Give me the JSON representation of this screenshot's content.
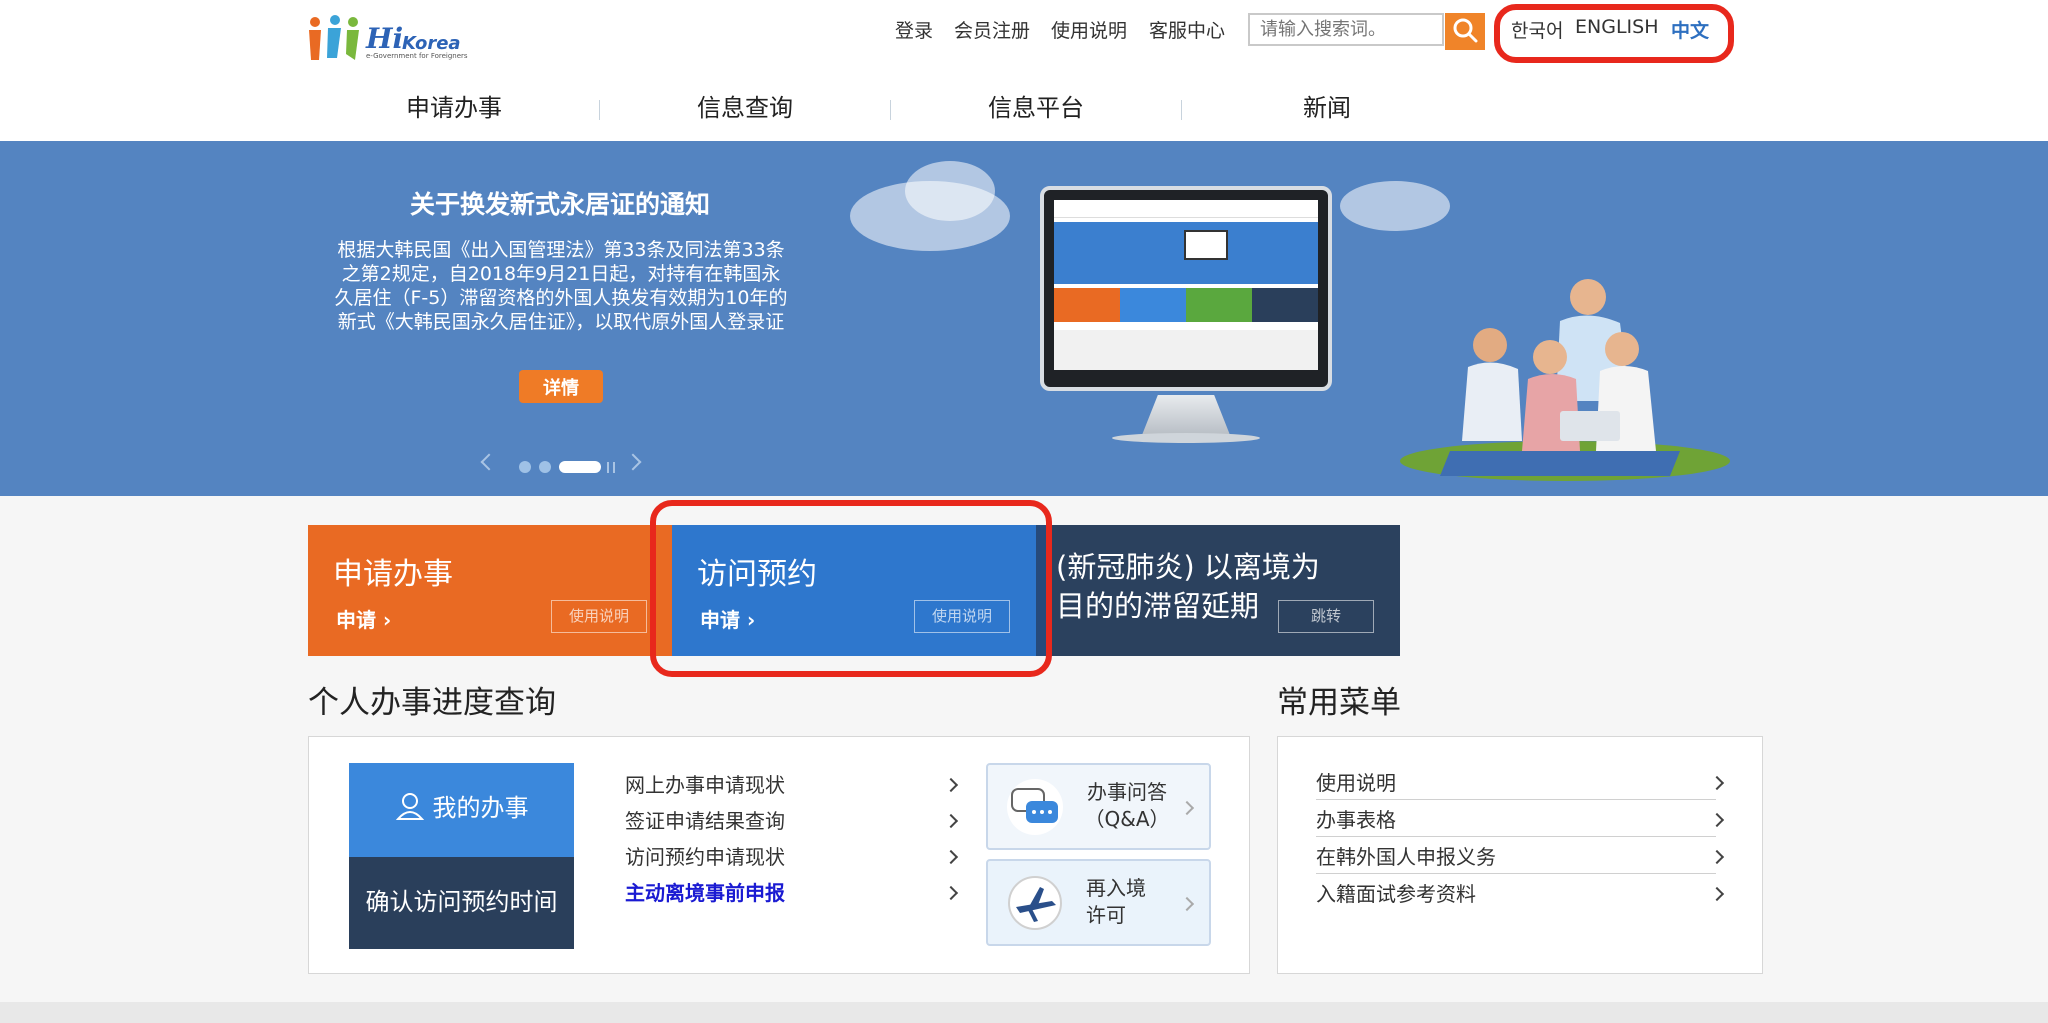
{
  "header": {
    "logo_hi": "Hi",
    "logo_korea": "Korea",
    "logo_tagline": "e-Government for Foreigners",
    "links": {
      "login": "登录",
      "register": "会员注册",
      "guide": "使用说明",
      "service": "客服中心"
    },
    "search_placeholder": "请输入搜索词。",
    "languages": {
      "korean": "한국어",
      "english": "ENGLISH",
      "chinese": "中文"
    }
  },
  "nav": {
    "apply": "申请办事",
    "inquiry": "信息查询",
    "platform": "信息平台",
    "news": "新闻"
  },
  "banner": {
    "title": "关于换发新式永居证的通知",
    "text": "根据大韩民国《出入国管理法》第33条及同法第33条之第2规定，自2018年9月21日起，对持有在韩国永久居住（F-5）滞留资格的外国人换发有效期为10年的新式《大韩民国永久居住证》，以取代原外国人登录证",
    "button": "详情",
    "slide_count": 3,
    "active_slide": 3
  },
  "tiles": {
    "apply": {
      "title": "申请办事",
      "link": "申请",
      "guide": "使用说明"
    },
    "visit": {
      "title": "访问预约",
      "link": "申请",
      "guide": "使用说明"
    },
    "covid": {
      "title_line1": "(新冠肺炎) 以离境为",
      "title_line2": "目的的滞留延期",
      "button": "跳转"
    }
  },
  "progress": {
    "title": "个人办事进度查询",
    "my_task": "我的办事",
    "confirm_visit": "确认访问预约时间",
    "links": [
      "网上办事申请现状",
      "签证申请结果查询",
      "访问预约申请现状",
      "主动离境事前申报"
    ],
    "qa": {
      "line1": "办事问答",
      "line2": "（Q&A）"
    },
    "reentry": {
      "line1": "再入境",
      "line2": "许可"
    }
  },
  "common_menu": {
    "title": "常用菜单",
    "items": [
      "使用说明",
      "办事表格",
      "在韩外国人申报义务",
      "入籍面试参考资料"
    ]
  },
  "colors": {
    "orange": "#e96a23",
    "blue": "#2e77cd",
    "navy": "#2b415e",
    "banner": "#5484c1",
    "highlight_red": "#e8281c"
  }
}
